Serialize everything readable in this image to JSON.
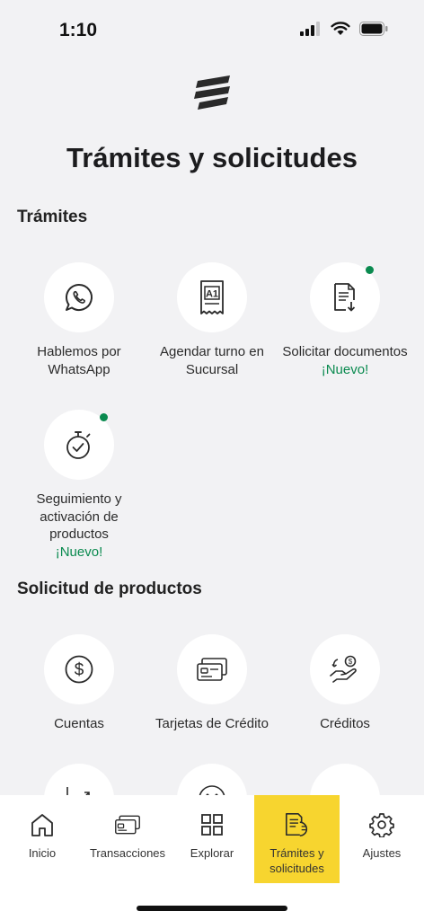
{
  "status": {
    "time": "1:10"
  },
  "page": {
    "title": "Trámites y solicitudes"
  },
  "sections": {
    "tramites": {
      "title": "Trámites",
      "items": [
        {
          "label": "Hablemos por WhatsApp",
          "icon": "whatsapp-icon"
        },
        {
          "label": "Agendar turno en Sucursal",
          "icon": "ticket-icon",
          "icon_text": "A1"
        },
        {
          "label": "Solicitar documentos",
          "badge": "¡Nuevo!",
          "icon": "document-download-icon"
        },
        {
          "label": "Seguimiento y activación de productos",
          "badge": "¡Nuevo!",
          "icon": "stopwatch-icon"
        }
      ]
    },
    "productos": {
      "title": "Solicitud de productos",
      "items": [
        {
          "label": "Cuentas",
          "icon": "dollar-coin-icon"
        },
        {
          "label": "Tarjetas de Crédito",
          "icon": "credit-card-icon"
        },
        {
          "label": "Créditos",
          "icon": "hand-money-icon"
        }
      ]
    }
  },
  "tabbar": {
    "items": [
      {
        "label": "Inicio",
        "icon": "home-icon"
      },
      {
        "label": "Transacciones",
        "icon": "cards-icon"
      },
      {
        "label": "Explorar",
        "icon": "grid-icon"
      },
      {
        "label": "Trámites y solicitudes",
        "icon": "documents-icon",
        "active": true
      },
      {
        "label": "Ajustes",
        "icon": "gear-icon"
      }
    ]
  },
  "colors": {
    "accent": "#f7d52f",
    "new_badge": "#0a8a4f",
    "background": "#f2f2f4"
  }
}
